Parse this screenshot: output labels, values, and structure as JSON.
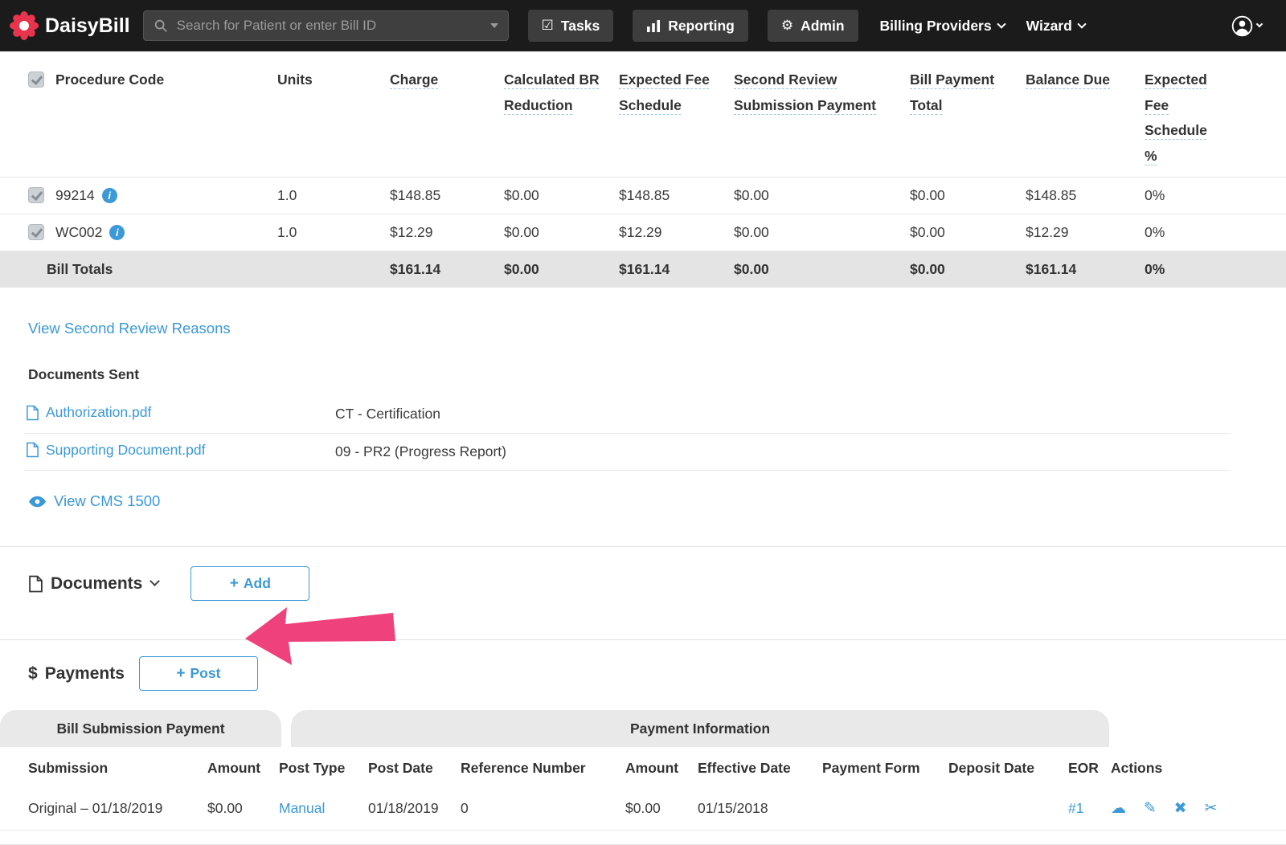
{
  "navbar": {
    "brand": "DaisyBill",
    "search": {
      "placeholder": "Search for Patient or enter Bill ID"
    },
    "tasks_label": "Tasks",
    "reporting_label": "Reporting",
    "admin_label": "Admin",
    "billing_providers_label": "Billing Providers",
    "wizard_label": "Wizard"
  },
  "icons": {
    "plus": "+",
    "gear": "⚙",
    "tasks": "☑",
    "dollar": "$",
    "info": "i",
    "cloud": "☁",
    "pencil": "✎",
    "delete_x": "✖",
    "scissors": "✂"
  },
  "line_items": {
    "headers": {
      "procedure_code": "Procedure Code",
      "units": "Units",
      "charge": "Charge",
      "calculated_br_reduction": "Calculated BR Reduction",
      "expected_fee_schedule": "Expected Fee Schedule",
      "second_review_submission_payment": "Second Review Submission Payment",
      "bill_payment_total": "Bill Payment Total",
      "balance_due": "Balance Due",
      "expected_fee_schedule_pct": "Expected Fee Schedule %"
    },
    "rows": [
      {
        "code": "99214",
        "units": "1.0",
        "charge": "$148.85",
        "br_reduction": "$0.00",
        "expected_fee": "$148.85",
        "second_review_payment": "$0.00",
        "bill_payment_total": "$0.00",
        "balance_due": "$148.85",
        "expected_fee_pct": "0%"
      },
      {
        "code": "WC002",
        "units": "1.0",
        "charge": "$12.29",
        "br_reduction": "$0.00",
        "expected_fee": "$12.29",
        "second_review_payment": "$0.00",
        "bill_payment_total": "$0.00",
        "balance_due": "$12.29",
        "expected_fee_pct": "0%"
      }
    ],
    "totals": {
      "label": "Bill Totals",
      "charge": "$161.14",
      "br_reduction": "$0.00",
      "expected_fee": "$161.14",
      "second_review_payment": "$0.00",
      "bill_payment_total": "$0.00",
      "balance_due": "$161.14",
      "expected_fee_pct": "0%"
    }
  },
  "second_review_link": "View Second Review Reasons",
  "documents_sent": {
    "title": "Documents Sent",
    "rows": [
      {
        "file_name": "Authorization.pdf",
        "doc_type": "CT - Certification"
      },
      {
        "file_name": "Supporting Document.pdf",
        "doc_type": "09 - PR2 (Progress Report)"
      }
    ]
  },
  "cms_link": "View CMS 1500",
  "documents_panel": {
    "title": "Documents",
    "add_label": "Add"
  },
  "payments_panel": {
    "title": "Payments",
    "post_label": "Post"
  },
  "payments_table": {
    "groups": {
      "left": "Bill Submission Payment",
      "right": "Payment Information"
    },
    "columns": {
      "submission": "Submission",
      "amount": "Amount",
      "post_type": "Post Type",
      "post_date": "Post Date",
      "reference_number": "Reference Number",
      "payment_amount": "Amount",
      "effective_date": "Effective Date",
      "payment_form": "Payment Form",
      "deposit_date": "Deposit Date",
      "eor": "EOR",
      "actions": "Actions"
    },
    "rows": [
      {
        "submission": "Original – 01/18/2019",
        "amount": "$0.00",
        "post_type": "Manual",
        "post_date": "01/18/2019",
        "reference_number": "0",
        "payment_amount": "$0.00",
        "effective_date": "01/15/2018",
        "payment_form": "",
        "deposit_date": "",
        "eor": "#1"
      }
    ]
  },
  "colors": {
    "link_blue": "#3b99d8",
    "arrow_pink": "#ef417c",
    "navbar_bg": "#1b1b1b",
    "totals_row_bg": "#e4e4e4",
    "tab_bg": "#e9e9e9"
  }
}
